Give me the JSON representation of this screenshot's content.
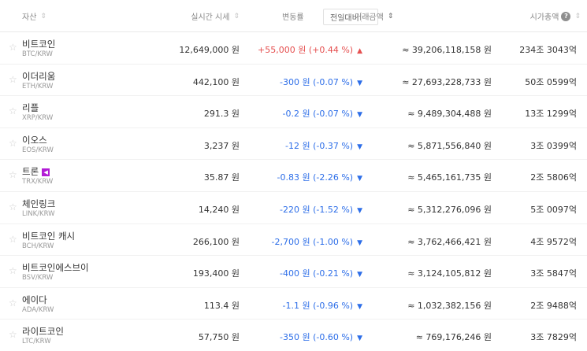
{
  "header": {
    "asset": "자산",
    "price": "실시간 시세",
    "change": "변동률",
    "change_period": "전일대비",
    "volume": "거래금액",
    "market_cap": "시가총액",
    "help": "?"
  },
  "rows": [
    {
      "name": "비트코인",
      "pair": "BTC/KRW",
      "price": "12,649,000 원",
      "change": "+55,000 원 (+0.44 %)",
      "direction": "up",
      "volume": "≈ 39,206,118,158 원",
      "cap": "234조 3043억"
    },
    {
      "name": "이더리움",
      "pair": "ETH/KRW",
      "price": "442,100 원",
      "change": "-300 원 (-0.07 %)",
      "direction": "down",
      "volume": "≈ 27,693,228,733 원",
      "cap": "50조 0599억"
    },
    {
      "name": "리플",
      "pair": "XRP/KRW",
      "price": "291.3 원",
      "change": "-0.2 원 (-0.07 %)",
      "direction": "down",
      "volume": "≈ 9,489,304,488 원",
      "cap": "13조 1299억"
    },
    {
      "name": "이오스",
      "pair": "EOS/KRW",
      "price": "3,237 원",
      "change": "-12 원 (-0.37 %)",
      "direction": "down",
      "volume": "≈ 5,871,556,840 원",
      "cap": "3조 0399억"
    },
    {
      "name": "트론",
      "pair": "TRX/KRW",
      "price": "35.87 원",
      "change": "-0.83 원 (-2.26 %)",
      "direction": "down",
      "volume": "≈ 5,465,161,735 원",
      "cap": "2조 5806억"
    },
    {
      "name": "체인링크",
      "pair": "LINK/KRW",
      "price": "14,240 원",
      "change": "-220 원 (-1.52 %)",
      "direction": "down",
      "volume": "≈ 5,312,276,096 원",
      "cap": "5조 0097억"
    },
    {
      "name": "비트코인 캐시",
      "pair": "BCH/KRW",
      "price": "266,100 원",
      "change": "-2,700 원 (-1.00 %)",
      "direction": "down",
      "volume": "≈ 3,762,466,421 원",
      "cap": "4조 9572억"
    },
    {
      "name": "비트코인에스브이",
      "pair": "BSV/KRW",
      "price": "193,400 원",
      "change": "-400 원 (-0.21 %)",
      "direction": "down",
      "volume": "≈ 3,124,105,812 원",
      "cap": "3조 5847억"
    },
    {
      "name": "에이다",
      "pair": "ADA/KRW",
      "price": "113.4 원",
      "change": "-1.1 원 (-0.96 %)",
      "direction": "down",
      "volume": "≈ 1,032,382,156 원",
      "cap": "2조 9488억"
    },
    {
      "name": "라이트코인",
      "pair": "LTC/KRW",
      "price": "57,750 원",
      "change": "-350 원 (-0.60 %)",
      "direction": "down",
      "volume": "≈ 769,176,246 원",
      "cap": "3조 7829억"
    }
  ]
}
